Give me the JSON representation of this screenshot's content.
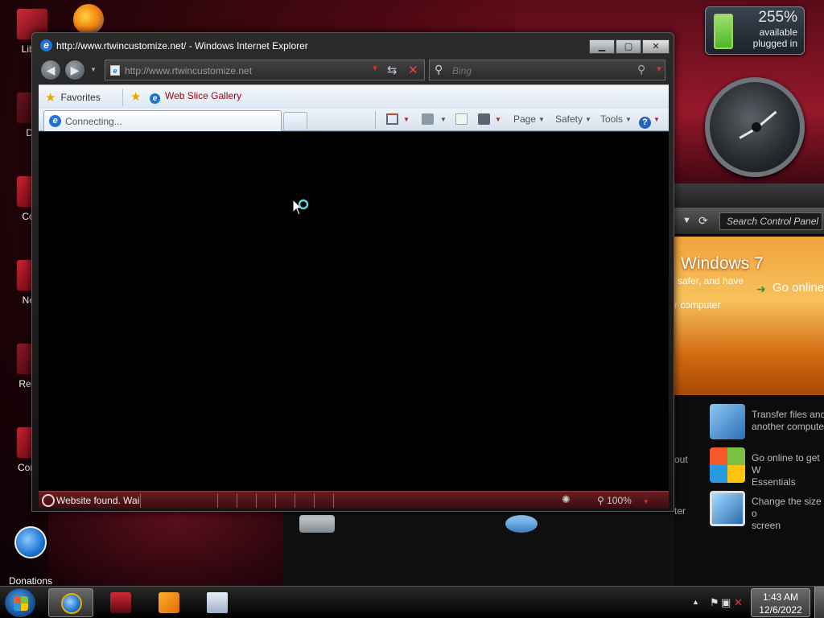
{
  "desktop": {
    "icons": [
      {
        "label": "Libra",
        "color": "#b8142a"
      },
      {
        "label": "Da",
        "color": "#5a1218"
      },
      {
        "label": "Com",
        "color": "#c01c2e"
      },
      {
        "label": "Netv",
        "color": "#b01428"
      },
      {
        "label": "Recyc",
        "color": "#7a1018"
      },
      {
        "label": "Contro",
        "color": "#b81428"
      },
      {
        "label": "Donations\nand VIP m...",
        "color": "#1e74d0"
      }
    ],
    "firefox_icon": "firefox-icon"
  },
  "gadgets": {
    "battery": {
      "percent": "255%",
      "line1": "available",
      "line2": "plugged in"
    },
    "clock_gadget": "analog-clock-icon"
  },
  "control_panel": {
    "search_placeholder": "Search Control Panel",
    "banner": {
      "title": "Windows 7",
      "line1": "safer, and have",
      "line2": "r computer",
      "go_online": "Go online"
    },
    "tasks": [
      {
        "text": "Transfer files and\nanother compute"
      },
      {
        "text": "Go online to get W\nEssentials"
      },
      {
        "text": "Change the size o\nscreen"
      }
    ],
    "side_texts": [
      "out",
      "ter"
    ]
  },
  "ie": {
    "title": "http://www.rtwincustomize.net/ - Windows Internet Explorer",
    "address": "http://www.rtwincustomize.net",
    "search_placeholder": "Bing",
    "favorites_label": "Favorites",
    "web_slice_label": "Web Slice Gallery",
    "tab_label": "Connecting...",
    "commands": {
      "page": "Page",
      "safety": "Safety",
      "tools": "Tools"
    },
    "status_text": "Website found. Wai",
    "zoom": "100%"
  },
  "taskbar": {
    "time": "1:43 AM",
    "date": "12/6/2022",
    "pinned": [
      "internet-explorer-icon",
      "desktop-folder-icon",
      "media-player-icon",
      "notepad-icon"
    ]
  }
}
